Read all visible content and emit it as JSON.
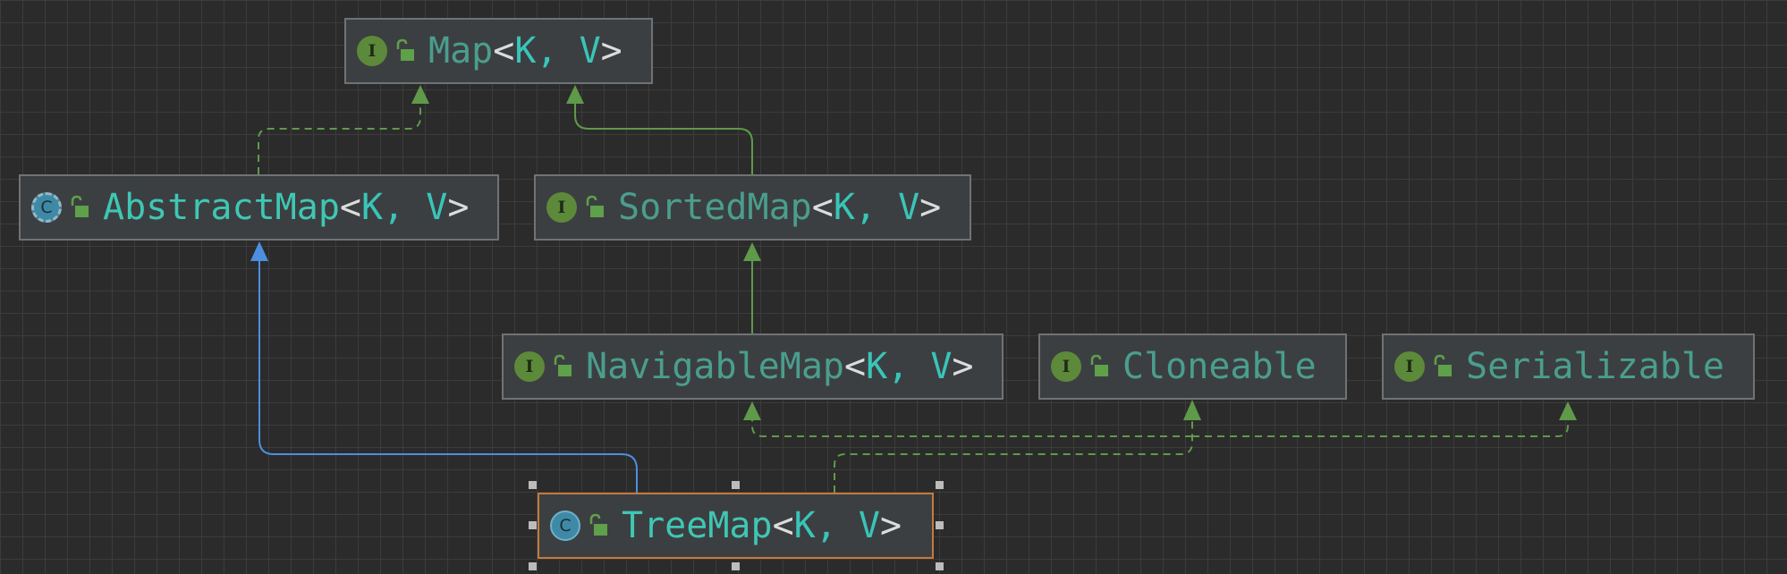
{
  "diagram": {
    "nodes": [
      {
        "id": "map",
        "name": "Map",
        "type_params": "K, V",
        "kind": "interface",
        "badge_letter": "I"
      },
      {
        "id": "abstractmap",
        "name": "AbstractMap",
        "type_params": "K, V",
        "kind": "abstract-class",
        "badge_letter": "C"
      },
      {
        "id": "sortedmap",
        "name": "SortedMap",
        "type_params": "K, V",
        "kind": "interface",
        "badge_letter": "I"
      },
      {
        "id": "navigablemap",
        "name": "NavigableMap",
        "type_params": "K, V",
        "kind": "interface",
        "badge_letter": "I"
      },
      {
        "id": "cloneable",
        "name": "Cloneable",
        "type_params": "",
        "kind": "interface",
        "badge_letter": "I"
      },
      {
        "id": "serializable",
        "name": "Serializable",
        "type_params": "",
        "kind": "interface",
        "badge_letter": "I"
      },
      {
        "id": "treemap",
        "name": "TreeMap",
        "type_params": "K, V",
        "kind": "class",
        "badge_letter": "C",
        "selected": true
      }
    ],
    "edges": [
      {
        "from": "abstractmap",
        "to": "map",
        "relation": "implements"
      },
      {
        "from": "sortedmap",
        "to": "map",
        "relation": "extends-interface"
      },
      {
        "from": "navigablemap",
        "to": "sortedmap",
        "relation": "extends-interface"
      },
      {
        "from": "treemap",
        "to": "abstractmap",
        "relation": "extends-class"
      },
      {
        "from": "treemap",
        "to": "navigablemap",
        "relation": "implements"
      },
      {
        "from": "treemap",
        "to": "cloneable",
        "relation": "implements"
      },
      {
        "from": "treemap",
        "to": "serializable",
        "relation": "implements"
      }
    ],
    "colors": {
      "background": "#2b2b2b",
      "grid": "#3c3c3c",
      "node_fill": "#3c3f41",
      "node_border": "#707375",
      "selected_border": "#c57a3b",
      "implements_edge": "#5f9a4a",
      "extends_interface_edge": "#5f9a4a",
      "extends_class_edge": "#4c8fe0",
      "interface_badge": "#5c8a3a",
      "class_badge": "#3e8aa6",
      "interface_name": "#4a9e8e",
      "class_name": "#3fc7b4",
      "type_param": "#39c5b9",
      "punctuation": "#dcdcdc"
    }
  }
}
